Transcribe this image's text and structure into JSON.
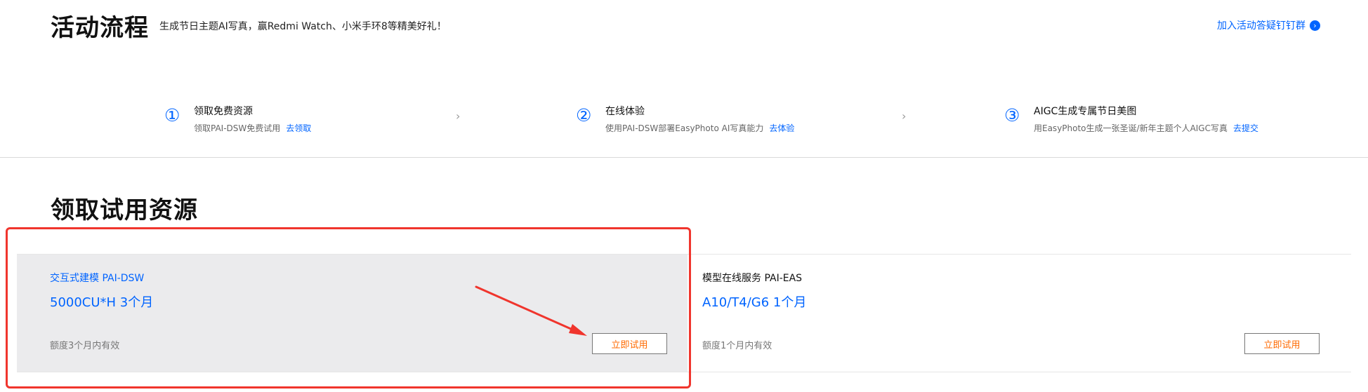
{
  "header": {
    "title": "活动流程",
    "subtitle": "生成节日主题AI写真，赢Redmi Watch、小米手环8等精美好礼！",
    "group_link": "加入活动答疑钉钉群",
    "group_link_icon": "›"
  },
  "steps": [
    {
      "number": "①",
      "title": "领取免费资源",
      "desc": "领取PAI-DSW免费试用",
      "link": "去领取"
    },
    {
      "number": "②",
      "title": "在线体验",
      "desc": "使用PAI-DSW部署EasyPhoto AI写真能力",
      "link": "去体验"
    },
    {
      "number": "③",
      "title": "AIGC生成专属节日美图",
      "desc": "用EasyPhoto生成一张圣诞/新年主题个人AIGC写真",
      "link": "去提交"
    }
  ],
  "step_chevron": "›",
  "section_title": "领取试用资源",
  "cards": [
    {
      "name": "交互式建模 PAI-DSW",
      "quota": "5000CU*H 3个月",
      "validity": "额度3个月内有效",
      "button": "立即试用"
    },
    {
      "name": "模型在线服务 PAI-EAS",
      "quota": "A10/T4/G6 1个月",
      "validity": "额度1个月内有效",
      "button": "立即试用"
    }
  ],
  "colors": {
    "accent": "#0064ff",
    "button_text": "#ff6a00",
    "annotation": "#f0352d"
  }
}
